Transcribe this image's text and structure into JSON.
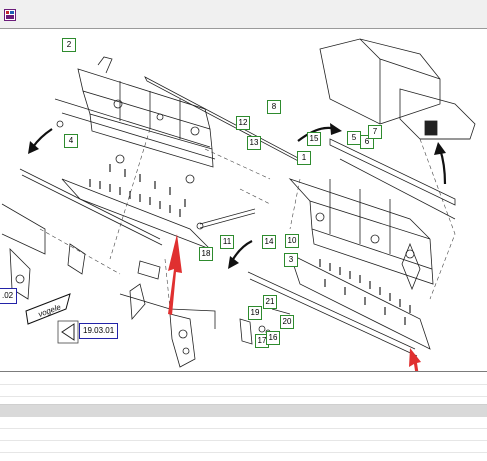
{
  "window": {
    "title_icon": "parts-catalog-icon"
  },
  "drawing": {
    "callouts": [
      {
        "id": "c2",
        "label": "2"
      },
      {
        "id": "c8",
        "label": "8"
      },
      {
        "id": "c12",
        "label": "12"
      },
      {
        "id": "c13",
        "label": "13"
      },
      {
        "id": "c4",
        "label": "4"
      },
      {
        "id": "c15",
        "label": "15"
      },
      {
        "id": "c5",
        "label": "5"
      },
      {
        "id": "c6",
        "label": "6"
      },
      {
        "id": "c7",
        "label": "7"
      },
      {
        "id": "c1",
        "label": "1"
      },
      {
        "id": "c11",
        "label": "11"
      },
      {
        "id": "c14",
        "label": "14"
      },
      {
        "id": "c10",
        "label": "10"
      },
      {
        "id": "c18",
        "label": "18"
      },
      {
        "id": "c3",
        "label": "3"
      },
      {
        "id": "c21",
        "label": "21"
      },
      {
        "id": "c19",
        "label": "19"
      },
      {
        "id": "c20",
        "label": "20"
      },
      {
        "id": "c17",
        "label": "17"
      },
      {
        "id": "c16",
        "label": "16"
      }
    ],
    "ref_left": ".02",
    "ref_main": "19.03.01",
    "logo_text": "vogele",
    "annotation_color": "#e03030",
    "callout_color": "#2e8b2e",
    "ref_color": "#2323a8"
  }
}
